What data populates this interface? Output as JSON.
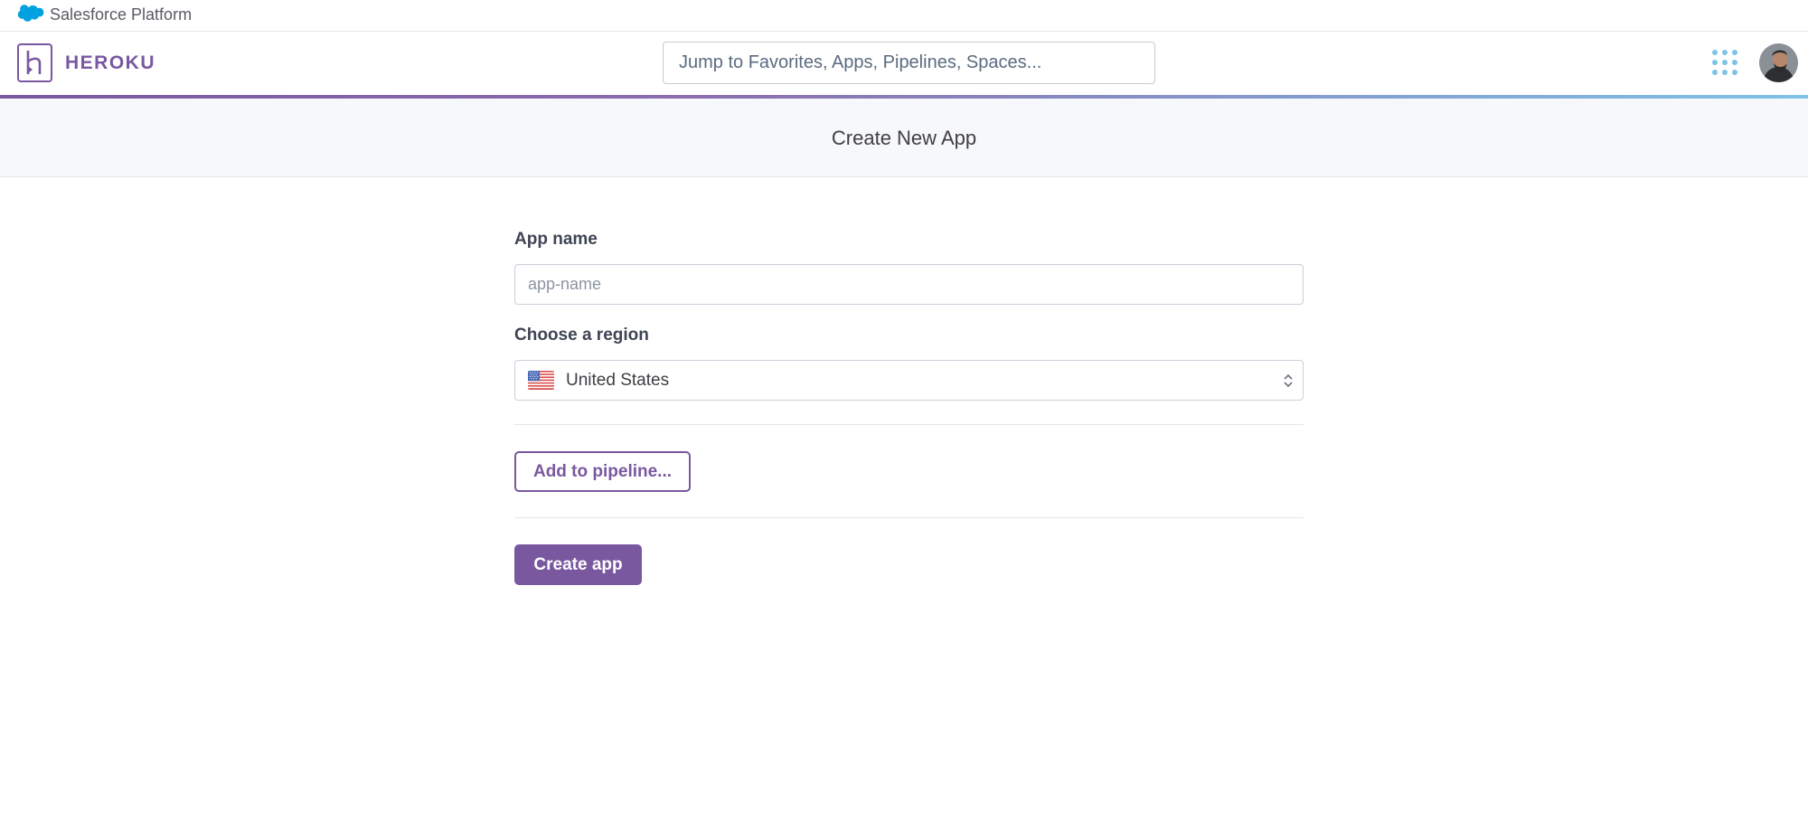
{
  "platform_bar": {
    "label": "Salesforce Platform",
    "icon": "salesforce-cloud-icon"
  },
  "header": {
    "logo_text": "HEROKU",
    "logo_icon": "heroku-logo-icon",
    "search": {
      "placeholder": "Jump to Favorites, Apps, Pipelines, Spaces..."
    },
    "apps_menu_icon": "grid-dots-icon",
    "avatar": "user-avatar"
  },
  "page": {
    "title": "Create New App"
  },
  "form": {
    "app_name": {
      "label": "App name",
      "placeholder": "app-name",
      "value": ""
    },
    "region": {
      "label": "Choose a region",
      "selected": "United States",
      "flag_icon": "us-flag-icon",
      "chevron_icon": "up-down-chevron-icon"
    },
    "pipeline_button": "Add to pipeline...",
    "create_button": "Create app"
  },
  "colors": {
    "brand_purple": "#79589f",
    "accent_blue": "#7ec3e6",
    "salesforce_blue": "#00a1e0",
    "subheader_bg": "#f7f8fb"
  }
}
